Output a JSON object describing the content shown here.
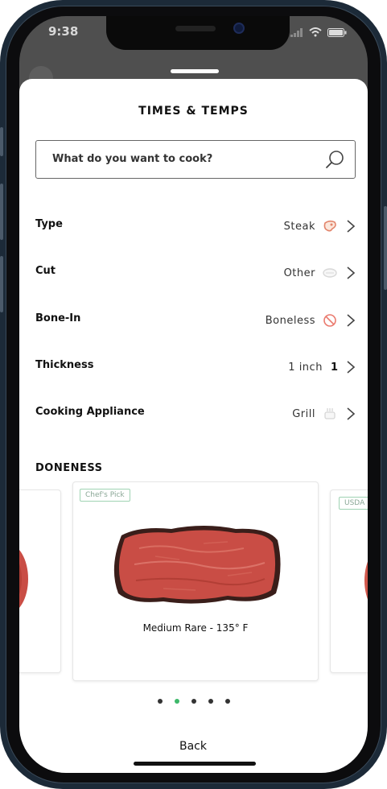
{
  "status_bar": {
    "time": "9:38"
  },
  "sheet": {
    "title": "TIMES & TEMPS",
    "search": {
      "placeholder": "What do you want to cook?"
    },
    "rows": [
      {
        "label": "Type",
        "value": "Steak",
        "icon": "steak-icon"
      },
      {
        "label": "Cut",
        "value": "Other",
        "icon": "other-cut-icon"
      },
      {
        "label": "Bone-In",
        "value": "Boneless",
        "icon": "no-bone-icon"
      },
      {
        "label": "Thickness",
        "value": "1 inch",
        "extra": "1"
      },
      {
        "label": "Cooking Appliance",
        "value": "Grill",
        "icon": "grill-icon"
      }
    ],
    "section_title": "DONENESS",
    "doneness_cards": [
      {
        "badge": "",
        "label": ""
      },
      {
        "badge": "Chef's Pick",
        "label": "Medium Rare - 135° F"
      },
      {
        "badge": "USDA",
        "label": ""
      }
    ],
    "pagination": {
      "total": 5,
      "active_index": 1
    },
    "back_label": "Back"
  },
  "colors": {
    "accent_green": "#3db86a",
    "badge_border": "#9fd3b3",
    "steak_red": "#c94d45",
    "frame": "#1c2a38"
  }
}
